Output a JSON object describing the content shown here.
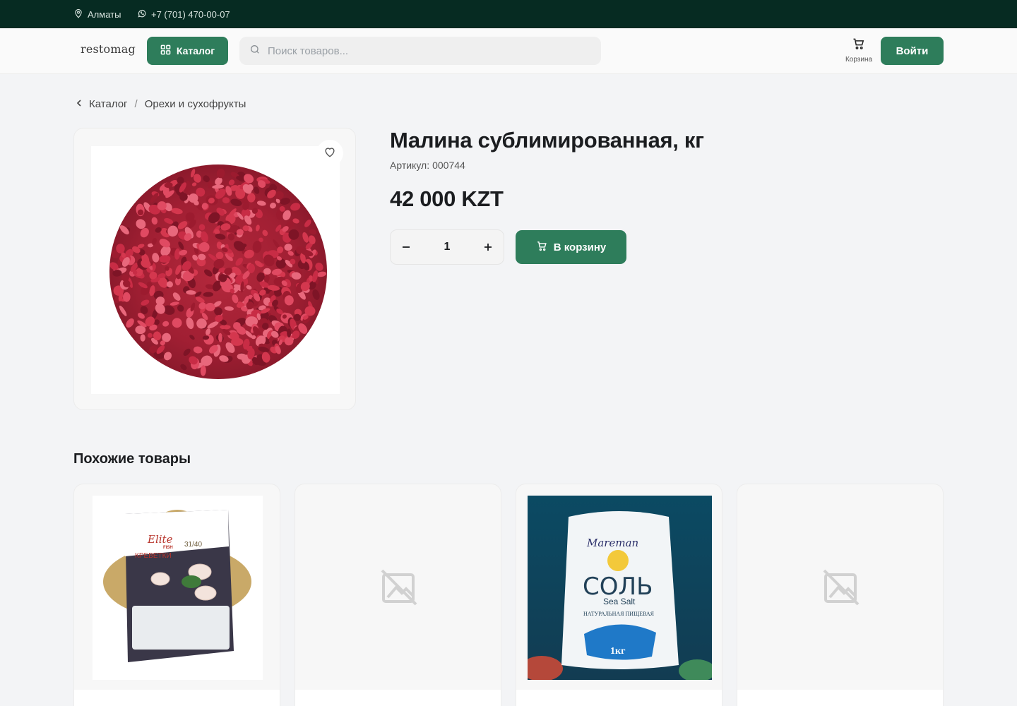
{
  "topbar": {
    "city": "Алматы",
    "phone": "+7 (701) 470-00-07"
  },
  "header": {
    "logo": "restomag",
    "catalog_label": "Каталог",
    "search_placeholder": "Поиск товаров...",
    "cart_label": "Корзина",
    "login_label": "Войти"
  },
  "breadcrumb": {
    "items": [
      "Каталог",
      "Орехи и сухофрукты"
    ],
    "separator": "/"
  },
  "product": {
    "title": "Малина сублимированная, кг",
    "sku_label": "Артикул:",
    "sku": "000744",
    "price": "42 000 KZT",
    "quantity": "1",
    "add_to_cart_label": "В корзину"
  },
  "similar": {
    "title": "Похожие товары",
    "cards": [
      {
        "image": "shrimp-package",
        "brand": "Elite",
        "brand_sub": "FISH",
        "size": "31/40",
        "name": "КРЕВЕТКИ"
      },
      {
        "image": "placeholder"
      },
      {
        "image": "salt-package",
        "brand": "Mareman",
        "name": "СОЛЬ",
        "sub": "Sea Salt",
        "desc": "НАТУРАЛЬНАЯ ПИЩЕВАЯ",
        "weight": "1кг"
      },
      {
        "image": "placeholder"
      }
    ]
  },
  "colors": {
    "brand_green": "#2e7d5b",
    "topbar_bg": "#062b22",
    "page_bg": "#f3f4f6"
  }
}
